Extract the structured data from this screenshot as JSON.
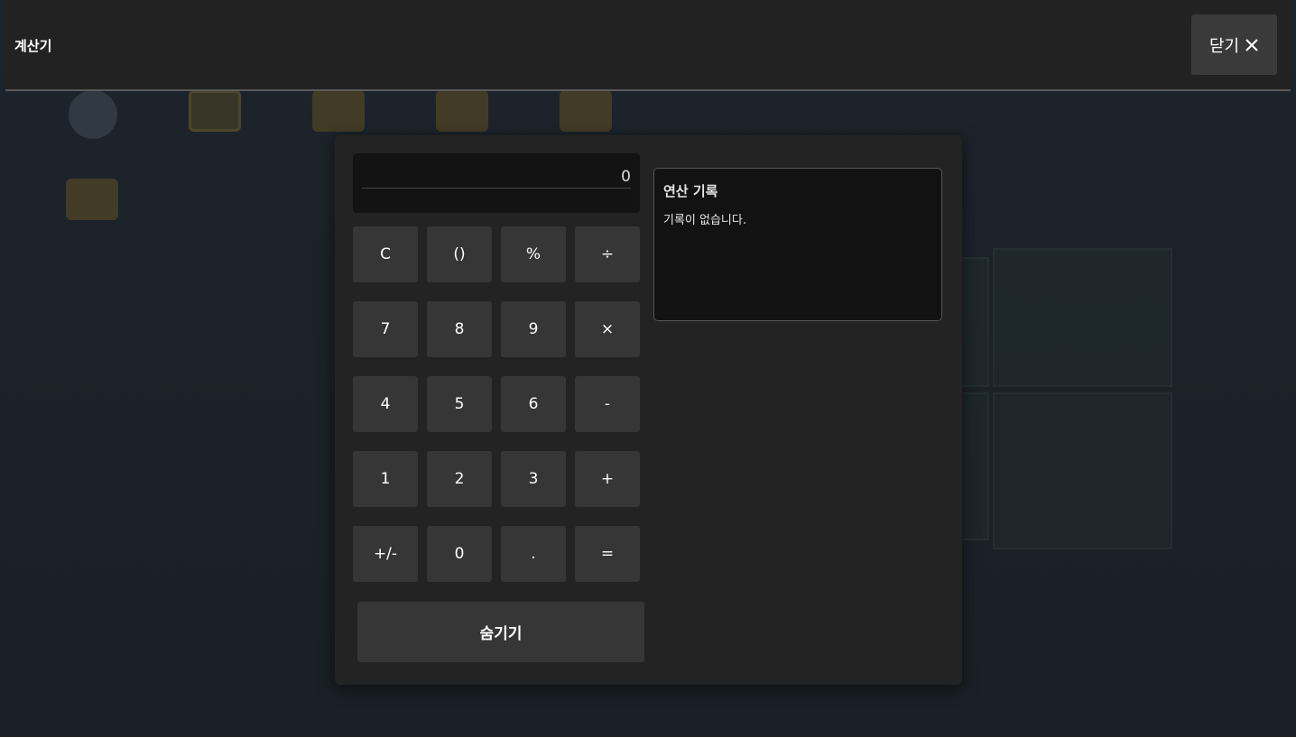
{
  "titlebar": {
    "title": "계산기",
    "close_label": "닫기",
    "close_icon": "close-icon"
  },
  "desktop": {
    "icons": [
      {
        "name": "folder-icon"
      },
      {
        "name": "book-icon"
      },
      {
        "name": "folder-icon"
      },
      {
        "name": "folder-icon"
      },
      {
        "name": "folder-icon"
      },
      {
        "name": "folder-icon"
      }
    ]
  },
  "calculator": {
    "display_value": "0",
    "keys": [
      [
        "C",
        "()",
        "%",
        "÷"
      ],
      [
        "7",
        "8",
        "9",
        "×"
      ],
      [
        "4",
        "5",
        "6",
        "-"
      ],
      [
        "1",
        "2",
        "3",
        "+"
      ],
      [
        "+/-",
        "0",
        ".",
        "="
      ]
    ],
    "hide_label": "숨기기",
    "history": {
      "title": "연산 기록",
      "empty_text": "기록이 없습니다."
    }
  },
  "colors": {
    "titlebar_bg": "#222222",
    "window_bg": "#232323",
    "key_bg": "#363636",
    "display_bg": "#131313"
  }
}
